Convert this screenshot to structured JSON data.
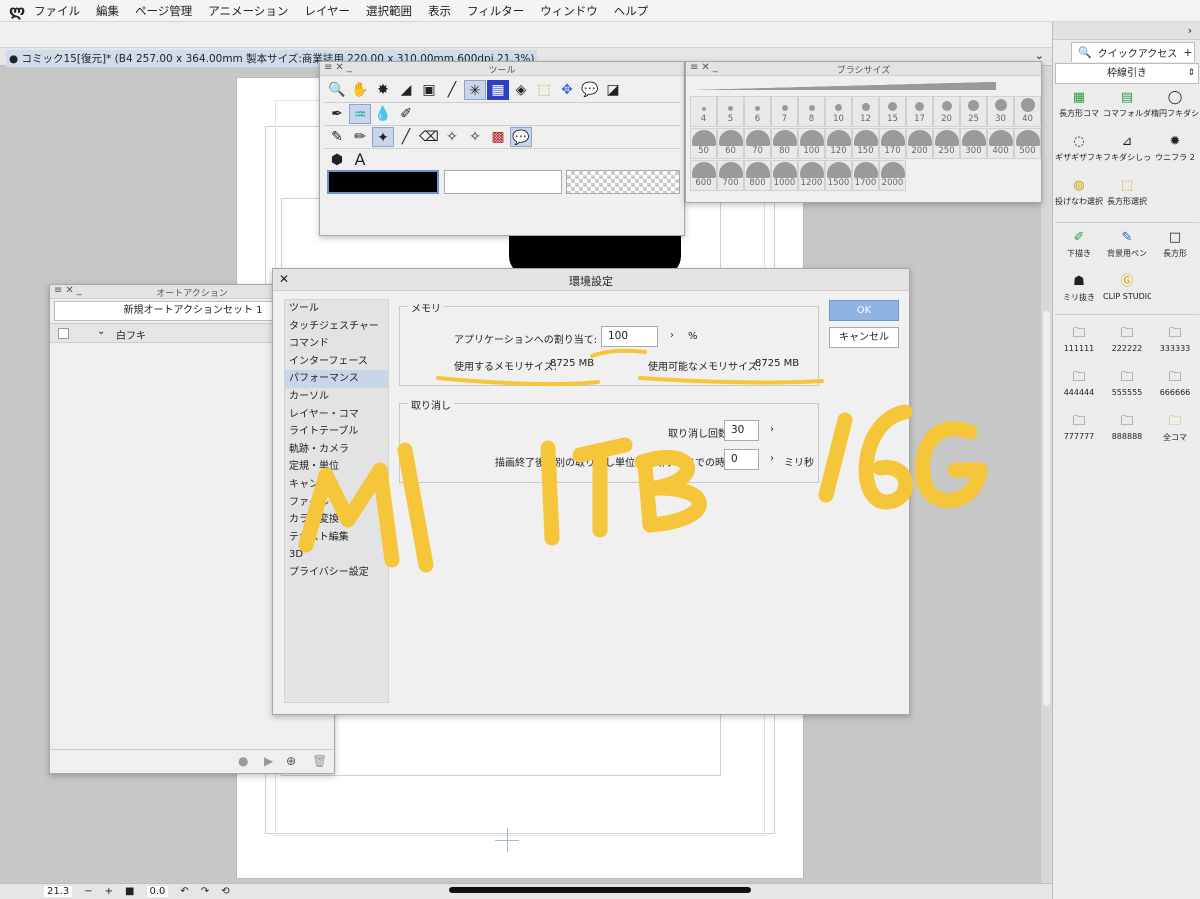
{
  "menu": {
    "items": [
      "ファイル",
      "編集",
      "ページ管理",
      "アニメーション",
      "レイヤー",
      "選択範囲",
      "表示",
      "フィルター",
      "ウィンドウ",
      "ヘルプ"
    ]
  },
  "document": {
    "tab_title": "● コミック15[復元]* (B4 257.00 x 364.00mm 製本サイズ:商業誌用 220.00 x 310.00mm 600dpi 21.3%)"
  },
  "bottom_bar": {
    "zoom_value": "21.3",
    "minus": "−",
    "plus": "+",
    "rotation_value": "0.0"
  },
  "quick_access": {
    "tab_label": "クイックアクセス",
    "set_name": "枠線引き",
    "items": [
      {
        "label": "長方形コマ",
        "icon": "rect-panel-icon"
      },
      {
        "label": "コマフォルダー",
        "icon": "panel-folder-icon"
      },
      {
        "label": "楕円フキダシ",
        "icon": "oval-balloon-icon"
      },
      {
        "label": "ギザギザフキダシ",
        "icon": "jagged-balloon-icon"
      },
      {
        "label": "フキダシしっぽ",
        "icon": "balloon-tail-icon"
      },
      {
        "label": "ウニフラ 2",
        "icon": "urchin-flash-icon"
      },
      {
        "label": "投げなわ選択",
        "icon": "lasso-icon"
      },
      {
        "label": "長方形選択",
        "icon": "rect-select-icon"
      },
      {
        "label": "下描き",
        "icon": "draft-pen-icon"
      },
      {
        "label": "背景用ペン",
        "icon": "background-pen-icon"
      },
      {
        "label": "長方形",
        "icon": "rectangle-icon"
      },
      {
        "label": "ミリ抜き",
        "icon": "silhouette-icon"
      },
      {
        "label": "CLIP STUDIO",
        "icon": "clip-studio-icon"
      },
      {
        "label": "111111",
        "icon": "folder-icon"
      },
      {
        "label": "222222",
        "icon": "folder-icon"
      },
      {
        "label": "333333",
        "icon": "folder-icon"
      },
      {
        "label": "444444",
        "icon": "folder-icon"
      },
      {
        "label": "555555",
        "icon": "folder-icon"
      },
      {
        "label": "666666",
        "icon": "folder-icon"
      },
      {
        "label": "777777",
        "icon": "folder-icon"
      },
      {
        "label": "888888",
        "icon": "folder-icon"
      },
      {
        "label": "全コマ",
        "icon": "folder-yellow-icon"
      }
    ]
  },
  "tool_palette": {
    "title": "ツール"
  },
  "brush_size": {
    "title": "ブラシサイズ",
    "sizes": [
      "4",
      "5",
      "6",
      "7",
      "8",
      "10",
      "12",
      "15",
      "17",
      "20",
      "25",
      "30",
      "40",
      "50",
      "60",
      "70",
      "80",
      "100",
      "120",
      "150",
      "170",
      "200",
      "250",
      "300",
      "400",
      "500",
      "600",
      "700",
      "800",
      "1000",
      "1200",
      "1500",
      "1700",
      "2000"
    ]
  },
  "auto_action": {
    "title": "オートアクション",
    "set_name": "新規オートアクションセット 1",
    "rows": [
      {
        "name": "白フキ"
      }
    ]
  },
  "preferences": {
    "title": "環境設定",
    "categories": [
      "ツール",
      "タッチジェスチャー",
      "コマンド",
      "インターフェース",
      "パフォーマンス",
      "カーソル",
      "レイヤー・コマ",
      "ライトテーブル",
      "軌跡・カメラ",
      "定規・単位",
      "キャンバス",
      "ファイル",
      "カラー変換",
      "テキスト編集",
      "3D",
      "プライバシー設定"
    ],
    "selected_index": 4,
    "memory": {
      "group_label": "メモリ",
      "alloc_label": "アプリケーションへの割り当て:",
      "alloc_value": "100",
      "alloc_unit": "%",
      "used_label": "使用するメモリサイズ:",
      "used_value": "8725 MB",
      "avail_label": "使用可能なメモリサイズ:",
      "avail_value": "8725 MB"
    },
    "undo": {
      "group_label": "取り消し",
      "count_label": "取り消し回数:",
      "count_value": "30",
      "time_label": "描画終了後、別の取り消し単位と判断するまでの時間:",
      "time_value": "0",
      "time_unit": "ミリ秒"
    },
    "ok_label": "OK",
    "cancel_label": "キャンセル"
  },
  "handwriting": [
    "M1",
    "1TB",
    "16G"
  ],
  "colors": {
    "highlight": "#f5c63a",
    "ok_button": "#8fb3e2",
    "selection": "#c9d6ea"
  }
}
